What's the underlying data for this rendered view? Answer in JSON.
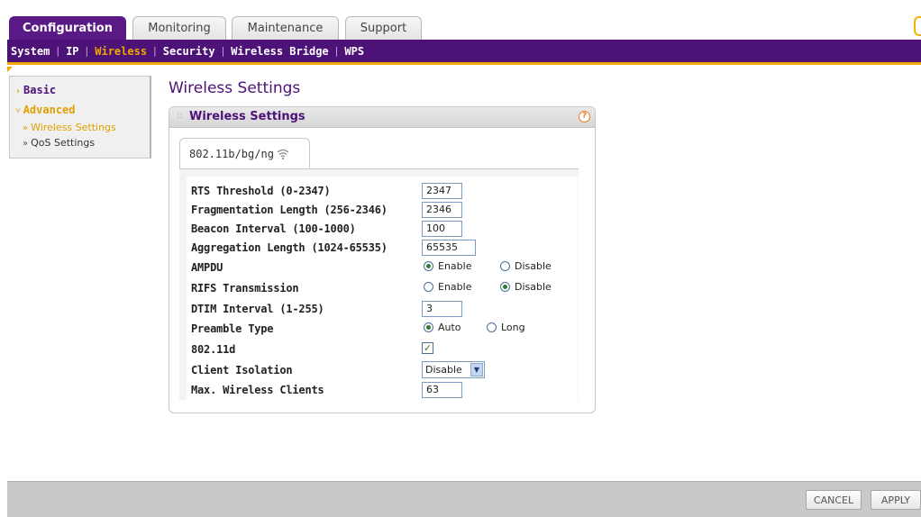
{
  "tabs": [
    {
      "label": "Configuration",
      "active": true
    },
    {
      "label": "Monitoring",
      "active": false
    },
    {
      "label": "Maintenance",
      "active": false
    },
    {
      "label": "Support",
      "active": false
    }
  ],
  "subnav": {
    "items": [
      "System",
      "IP",
      "Wireless",
      "Security",
      "Wireless Bridge",
      "WPS"
    ],
    "current": "Wireless"
  },
  "leftmenu": {
    "basic": "Basic",
    "advanced": "Advanced",
    "wireless_settings": "Wireless Settings",
    "qos_settings": "QoS Settings"
  },
  "page_title": "Wireless Settings",
  "panel": {
    "title": "Wireless Settings",
    "help": "?",
    "mode_tab": "802.11b/bg/ng"
  },
  "settings": {
    "rts_label": "RTS Threshold (0-2347)",
    "rts_value": "2347",
    "frag_label": "Fragmentation Length (256-2346)",
    "frag_value": "2346",
    "beacon_label": "Beacon Interval (100-1000)",
    "beacon_value": "100",
    "agg_label": "Aggregation Length (1024-65535)",
    "agg_value": "65535",
    "ampdu_label": "AMPDU",
    "ampdu_enable": "Enable",
    "ampdu_disable": "Disable",
    "ampdu_selected": "Enable",
    "rifs_label": "RIFS Transmission",
    "rifs_enable": "Enable",
    "rifs_disable": "Disable",
    "rifs_selected": "Disable",
    "dtim_label": "DTIM Interval (1-255)",
    "dtim_value": "3",
    "preamble_label": "Preamble Type",
    "preamble_auto": "Auto",
    "preamble_long": "Long",
    "preamble_selected": "Auto",
    "d11_label": "802.11d",
    "d11_checked": true,
    "isolation_label": "Client Isolation",
    "isolation_value": "Disable",
    "maxclients_label": "Max. Wireless Clients",
    "maxclients_value": "63"
  },
  "footer": {
    "cancel": "CANCEL",
    "apply": "APPLY"
  },
  "colors": {
    "brand_purple": "#4d1278",
    "accent_orange": "#f0a800",
    "radio_selected": "#2e7d32"
  }
}
